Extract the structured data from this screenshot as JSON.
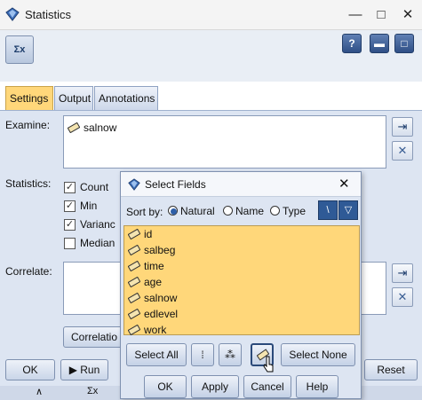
{
  "window": {
    "title": "Statistics"
  },
  "tabs": [
    {
      "label": "Settings"
    },
    {
      "label": "Output"
    },
    {
      "label": "Annotations"
    }
  ],
  "settings": {
    "examine_label": "Examine:",
    "examine_fields": [
      "salnow"
    ],
    "statistics_label": "Statistics:",
    "stats": [
      {
        "label": "Count",
        "checked": true
      },
      {
        "label": "Min",
        "checked": true
      },
      {
        "label": "Varianc",
        "checked": true
      },
      {
        "label": "Median",
        "checked": false
      }
    ],
    "correlate_label": "Correlate:",
    "correlations_button": "Correlatio"
  },
  "bottom_bar": {
    "ok": "OK",
    "run": "Run",
    "reset": "Reset"
  },
  "dialog": {
    "title": "Select Fields",
    "sort_by_label": "Sort by:",
    "sort_options": [
      {
        "label": "Natural",
        "selected": true
      },
      {
        "label": "Name",
        "selected": false
      },
      {
        "label": "Type",
        "selected": false
      }
    ],
    "fields": [
      "id",
      "salbeg",
      "time",
      "age",
      "salnow",
      "edlevel",
      "work"
    ],
    "select_all": "Select All",
    "select_none": "Select None",
    "ok": "OK",
    "apply": "Apply",
    "cancel": "Cancel",
    "help": "Help"
  },
  "colors": {
    "selection": "#ffd77a",
    "panel": "#dde5f2",
    "accent": "#2f4f86"
  }
}
